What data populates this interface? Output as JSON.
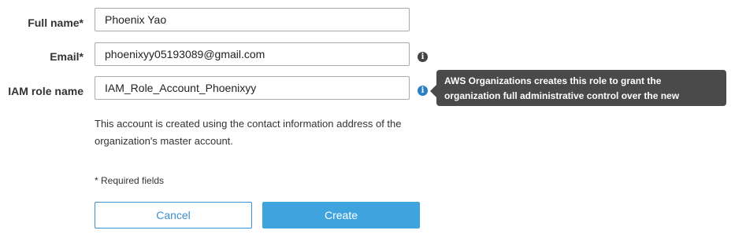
{
  "form": {
    "full_name": {
      "label": "Full name*",
      "value": "Phoenix Yao"
    },
    "email": {
      "label": "Email*",
      "value": "phoenixyy05193089@gmail.com"
    },
    "iam_role": {
      "label": "IAM role name",
      "value": "IAM_Role_Account_Phoenixyy"
    },
    "help_text": "This account is created using the contact information address of the organization's master account.",
    "required_note": "* Required fields"
  },
  "tooltip": {
    "text": "AWS Organizations creates this role to grant the organization full administrative control over the new account."
  },
  "icons": {
    "email_info": "info-icon",
    "iam_info": "info-icon"
  },
  "actions": {
    "cancel_label": "Cancel",
    "create_label": "Create"
  },
  "colors": {
    "primary": "#3fa4de",
    "cancel_border": "#3d8fce",
    "tooltip_bg": "#4a4a4a",
    "info_active": "#2b7fc4"
  }
}
